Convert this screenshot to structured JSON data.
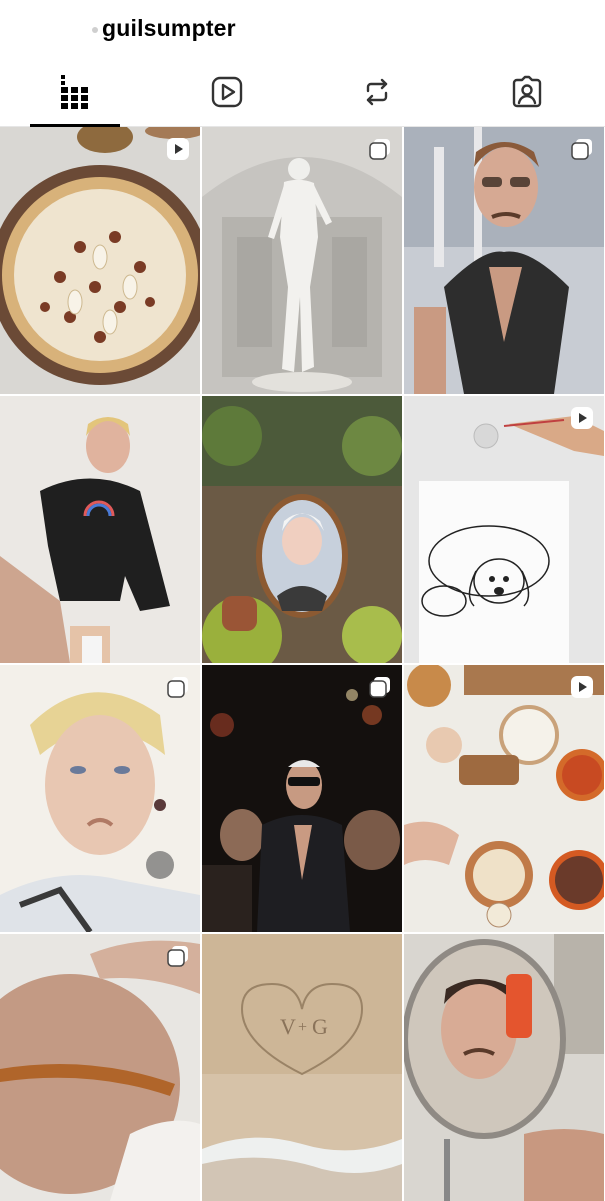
{
  "profile": {
    "username": "guilsumpter"
  },
  "tabs": [
    {
      "name": "posts",
      "icon": "grid-icon",
      "selected": true
    },
    {
      "name": "reels",
      "icon": "reels-icon",
      "selected": false
    },
    {
      "name": "reposts",
      "icon": "repost-icon",
      "selected": false
    },
    {
      "name": "tagged",
      "icon": "tagged-icon",
      "selected": false
    }
  ],
  "posts": [
    {
      "subject": "pear pizza",
      "badge": "reel-icon"
    },
    {
      "subject": "statue of David",
      "badge": "carousel-icon"
    },
    {
      "subject": "man in leather vest",
      "badge": "carousel-icon"
    },
    {
      "subject": "man in black sweatshirt",
      "badge": ""
    },
    {
      "subject": "mirror portrait among plants",
      "badge": ""
    },
    {
      "subject": "dog drawing",
      "badge": "reel-icon"
    },
    {
      "subject": "painted portrait",
      "badge": "carousel-icon"
    },
    {
      "subject": "party crowd",
      "badge": "carousel-icon"
    },
    {
      "subject": "cooking ingredients",
      "badge": "reel-icon"
    },
    {
      "subject": "close-up body",
      "badge": "carousel-icon"
    },
    {
      "subject": "heart drawn in sand",
      "badge": ""
    },
    {
      "subject": "mirror selfie",
      "badge": ""
    }
  ],
  "colors": {
    "accent": "#000000",
    "divider": "#e6e6e6",
    "icon": "#333333"
  }
}
